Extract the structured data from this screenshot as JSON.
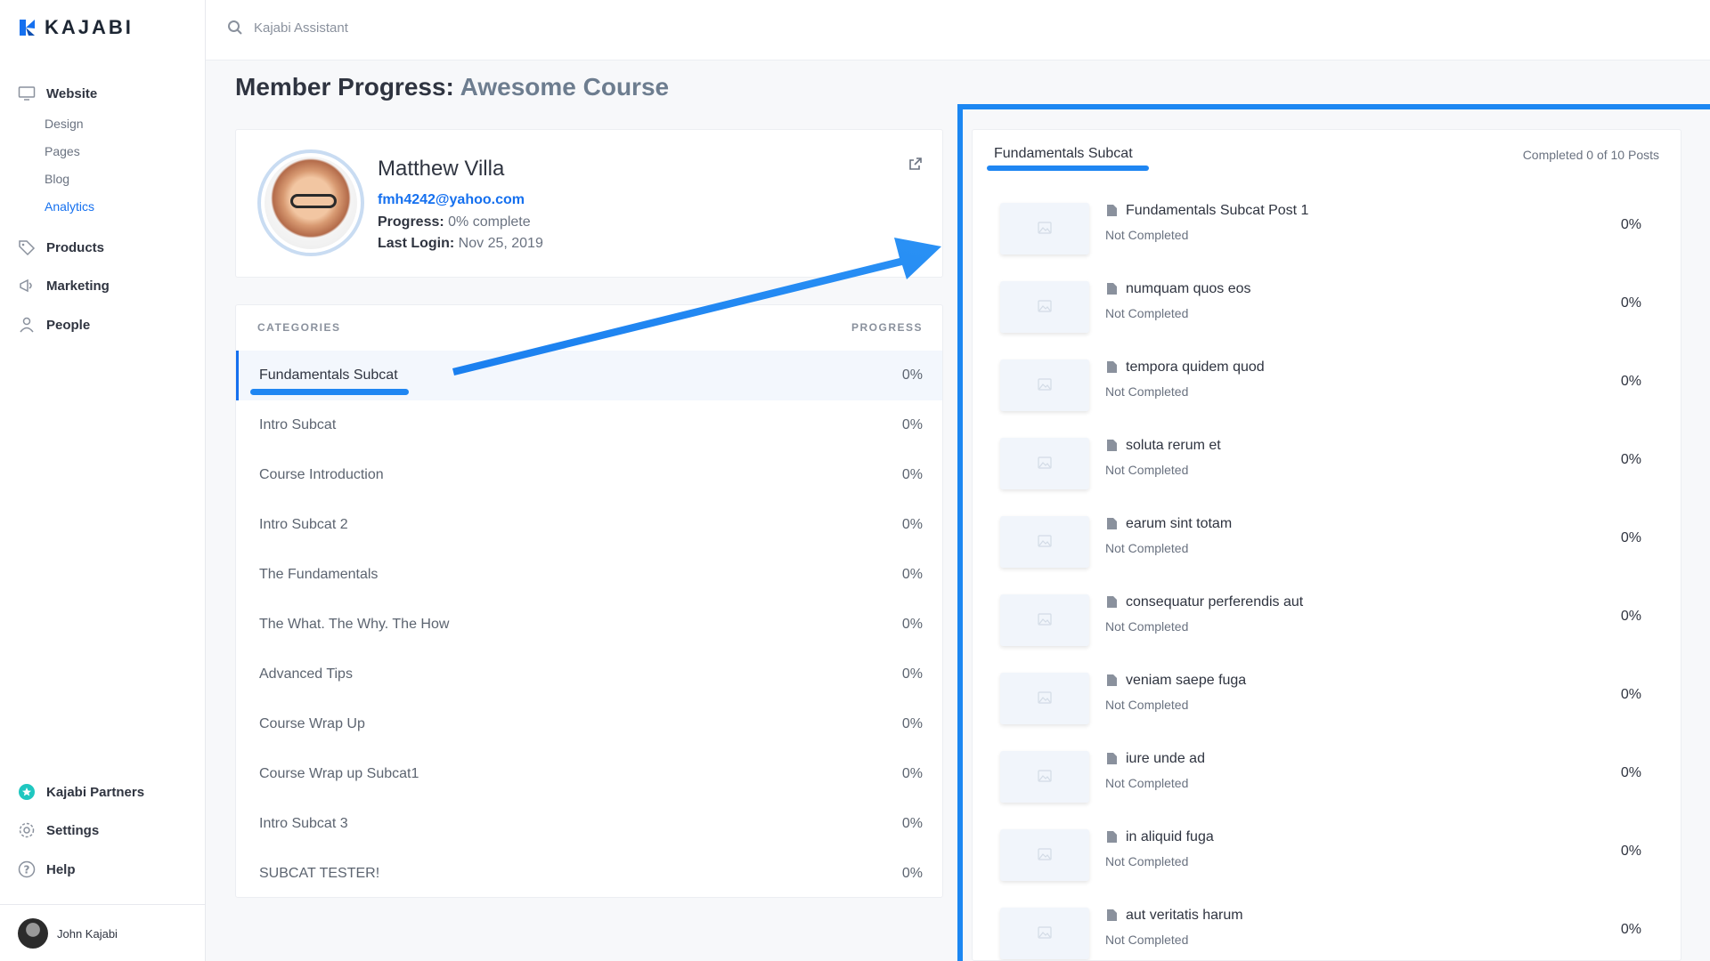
{
  "app": {
    "brand": "KAJABI"
  },
  "sidebar": {
    "website": "Website",
    "sub": [
      "Design",
      "Pages",
      "Blog",
      "Analytics"
    ],
    "products": "Products",
    "marketing": "Marketing",
    "people": "People",
    "partners": "Kajabi Partners",
    "settings": "Settings",
    "help": "Help",
    "user": "John Kajabi"
  },
  "search": {
    "placeholder": "Kajabi Assistant"
  },
  "page": {
    "title_prefix": "Member Progress:",
    "course": "Awesome Course"
  },
  "member": {
    "name": "Matthew Villa",
    "email": "fmh4242@yahoo.com",
    "progress_label": "Progress:",
    "progress_value": "0% complete",
    "login_label": "Last Login:",
    "login_value": "Nov 25, 2019"
  },
  "categories": {
    "head_left": "CATEGORIES",
    "head_right": "PROGRESS",
    "rows": [
      {
        "name": "Fundamentals Subcat",
        "pct": "0%"
      },
      {
        "name": "Intro Subcat",
        "pct": "0%"
      },
      {
        "name": "Course Introduction",
        "pct": "0%"
      },
      {
        "name": "Intro Subcat 2",
        "pct": "0%"
      },
      {
        "name": "The Fundamentals",
        "pct": "0%"
      },
      {
        "name": "The What. The Why. The How",
        "pct": "0%"
      },
      {
        "name": "Advanced Tips",
        "pct": "0%"
      },
      {
        "name": "Course Wrap Up",
        "pct": "0%"
      },
      {
        "name": "Course Wrap up Subcat1",
        "pct": "0%"
      },
      {
        "name": "Intro Subcat 3",
        "pct": "0%"
      },
      {
        "name": "SUBCAT TESTER!",
        "pct": "0%"
      }
    ]
  },
  "posts": {
    "title": "Fundamentals Subcat",
    "count": "Completed 0 of 10 Posts",
    "items": [
      {
        "name": "Fundamentals Subcat Post 1",
        "status": "Not Completed",
        "pct": "0%"
      },
      {
        "name": "numquam quos eos",
        "status": "Not Completed",
        "pct": "0%"
      },
      {
        "name": "tempora quidem quod",
        "status": "Not Completed",
        "pct": "0%"
      },
      {
        "name": "soluta rerum et",
        "status": "Not Completed",
        "pct": "0%"
      },
      {
        "name": "earum sint totam",
        "status": "Not Completed",
        "pct": "0%"
      },
      {
        "name": "consequatur perferendis aut",
        "status": "Not Completed",
        "pct": "0%"
      },
      {
        "name": "veniam saepe fuga",
        "status": "Not Completed",
        "pct": "0%"
      },
      {
        "name": "iure unde ad",
        "status": "Not Completed",
        "pct": "0%"
      },
      {
        "name": "in aliquid fuga",
        "status": "Not Completed",
        "pct": "0%"
      },
      {
        "name": "aut veritatis harum",
        "status": "Not Completed",
        "pct": "0%"
      }
    ]
  },
  "colors": {
    "accent": "#1570ef",
    "annotation": "#1c87f2"
  }
}
